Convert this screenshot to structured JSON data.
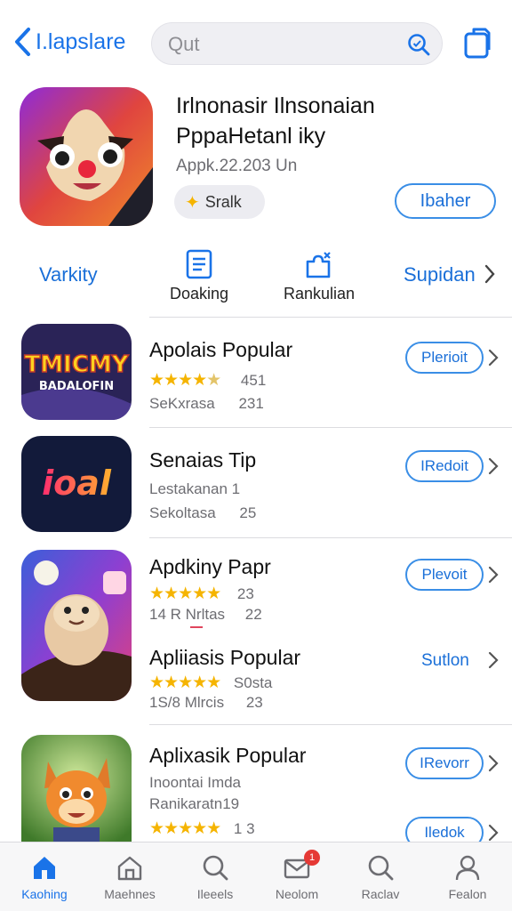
{
  "header": {
    "back_label": "I.lapslare",
    "search_placeholder": "Qut"
  },
  "hero": {
    "title_line1": "Irlnonasir Ilnsonaian",
    "title_line2": "PppaHetanl iky",
    "version": "Appk.22.203 Un",
    "chip_label": "Sralk",
    "action_label": "Ibaher"
  },
  "categories": {
    "left_label": "Varkity",
    "items": [
      {
        "label": "Doaking",
        "icon": "document-icon"
      },
      {
        "label": "Rankulian",
        "icon": "puzzle-icon"
      }
    ],
    "right_label": "Supidan"
  },
  "apps": [
    {
      "name": "Apolais Popular",
      "rating_stars": 4,
      "rating_value": "451",
      "sub_left": "SeKxrasa",
      "sub_right": "231",
      "button": "Plerioit",
      "icon_text_top": "TMICMY",
      "icon_text_bottom": "BADALOFIN"
    },
    {
      "name": "Senaias Tip",
      "sub1": "Lestakanan 1",
      "sub_left": "Sekoltasa",
      "sub_right": "25",
      "button": "IRedoit",
      "icon_text": "ioal"
    },
    {
      "name": "Apdkiny Papr",
      "rating_stars": 5,
      "rating_value": "23",
      "sub_left": "14 R Nrltas",
      "sub_right": "22",
      "button": "Plevoit"
    },
    {
      "name": "Apliiasis Popular",
      "rating_stars": 5,
      "rating_value": "S0sta",
      "sub_left": "1S/8 Mlrcis",
      "sub_right": "23",
      "button": "Sutlon"
    },
    {
      "name": "Aplixasik Popular",
      "sub1": "Inoontai Imda",
      "sub2": "Ranikaratn19",
      "rating_stars": 5,
      "rating_value": "1 3",
      "button": "IRevorr",
      "button2": "Iledok"
    }
  ],
  "tabs": [
    {
      "label": "Kaohing",
      "icon": "home-icon",
      "active": true
    },
    {
      "label": "Maehnes",
      "icon": "apps-icon"
    },
    {
      "label": "Ileeels",
      "icon": "search-icon"
    },
    {
      "label": "Neolom",
      "icon": "mail-icon",
      "badge": "1"
    },
    {
      "label": "Raclav",
      "icon": "search-icon"
    },
    {
      "label": "Fealon",
      "icon": "profile-icon"
    }
  ],
  "colors": {
    "accent": "#1a73e8",
    "star": "#f5b400",
    "badge": "#e53935"
  }
}
